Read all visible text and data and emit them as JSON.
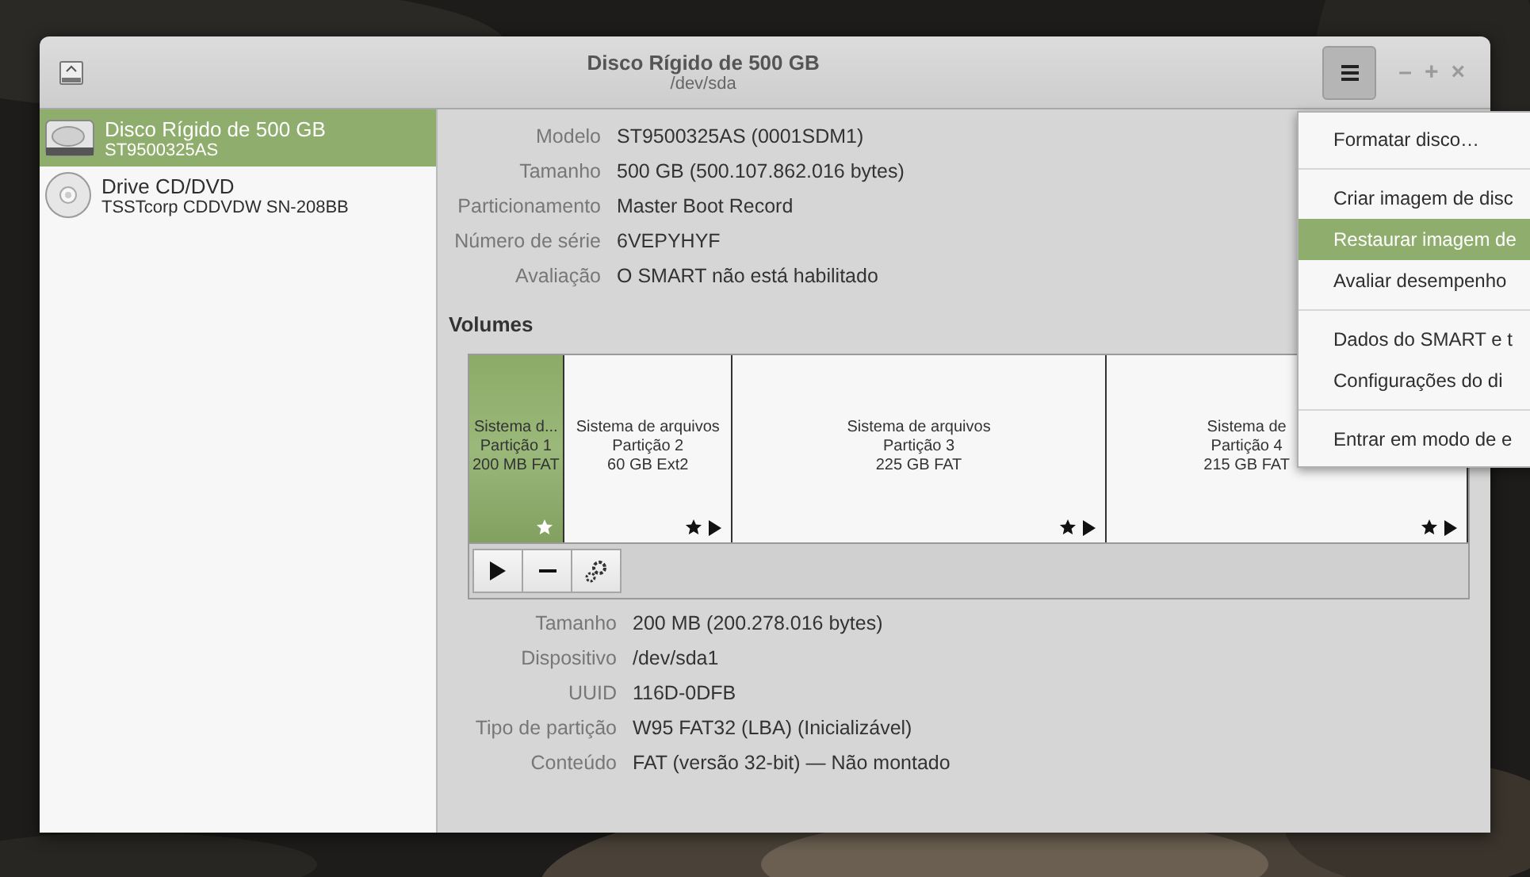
{
  "window": {
    "title": "Disco Rígido de 500 GB",
    "subtitle": "/dev/sda",
    "controls": [
      "–",
      "+",
      "×"
    ]
  },
  "sidebar": {
    "items": [
      {
        "name": "Disco Rígido de 500 GB",
        "detail": "ST9500325AS",
        "kind": "disk",
        "selected": true
      },
      {
        "name": "Drive CD/DVD",
        "detail": "TSSTcorp CDDVDW SN-208BB",
        "kind": "optical",
        "selected": false
      }
    ]
  },
  "disk_info": [
    {
      "label": "Modelo",
      "value": "ST9500325AS (0001SDM1)"
    },
    {
      "label": "Tamanho",
      "value": "500 GB (500.107.862.016 bytes)"
    },
    {
      "label": "Particionamento",
      "value": "Master Boot Record"
    },
    {
      "label": "Número de série",
      "value": "6VEPYHYF"
    },
    {
      "label": "Avaliação",
      "value": "O SMART não está habilitado"
    }
  ],
  "volumes": {
    "heading": "Volumes",
    "partitions": [
      {
        "lines": [
          "Sistema d...",
          "Partição 1",
          "200 MB FAT"
        ],
        "selected": true,
        "arrow": false
      },
      {
        "lines": [
          "Sistema de arquivos",
          "Partição 2",
          "60 GB Ext2"
        ],
        "selected": false,
        "arrow": true
      },
      {
        "lines": [
          "Sistema de arquivos",
          "Partição 3",
          "225 GB FAT"
        ],
        "selected": false,
        "arrow": true
      },
      {
        "lines": [
          "Sistema de",
          "Partição 4",
          "215 GB FAT"
        ],
        "selected": false,
        "arrow": true
      }
    ]
  },
  "volume_info": [
    {
      "label": "Tamanho",
      "value": "200 MB (200.278.016 bytes)"
    },
    {
      "label": "Dispositivo",
      "value": "/dev/sda1"
    },
    {
      "label": "UUID",
      "value": "116D-0DFB"
    },
    {
      "label": "Tipo de partição",
      "value": "W95 FAT32 (LBA) (Inicializável)"
    },
    {
      "label": "Conteúdo",
      "value": "FAT (versão 32-bit) — Não montado"
    }
  ],
  "menu": {
    "sections": [
      [
        {
          "label": "Formatar disco…",
          "selected": false
        }
      ],
      [
        {
          "label": "Criar imagem de disc",
          "selected": false
        },
        {
          "label": "Restaurar imagem de",
          "selected": true
        },
        {
          "label": "Avaliar desempenho",
          "selected": false
        }
      ],
      [
        {
          "label": "Dados do SMART e t",
          "selected": false
        },
        {
          "label": "Configurações do di",
          "selected": false
        }
      ],
      [
        {
          "label": "Entrar em modo de e",
          "selected": false
        }
      ]
    ]
  }
}
